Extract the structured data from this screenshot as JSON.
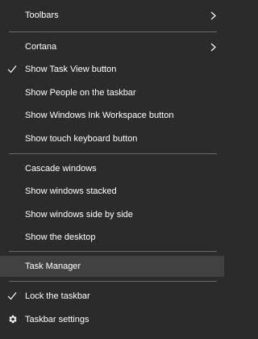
{
  "menu": {
    "toolbars": "Toolbars",
    "cortana": "Cortana",
    "show_task_view": "Show Task View button",
    "show_people": "Show People on the taskbar",
    "show_ink": "Show Windows Ink Workspace button",
    "show_touch_keyboard": "Show touch keyboard button",
    "cascade": "Cascade windows",
    "stacked": "Show windows stacked",
    "side_by_side": "Show windows side by side",
    "show_desktop": "Show the desktop",
    "task_manager": "Task Manager",
    "lock_taskbar": "Lock the taskbar",
    "taskbar_settings": "Taskbar settings"
  },
  "icons": {
    "submenu": "chevron-right-icon",
    "checked": "checkmark-icon",
    "settings": "gear-icon"
  },
  "colors": {
    "background": "#2b2b2b",
    "highlight": "#414141",
    "separator": "#6a6a6a",
    "text": "#ffffff"
  }
}
